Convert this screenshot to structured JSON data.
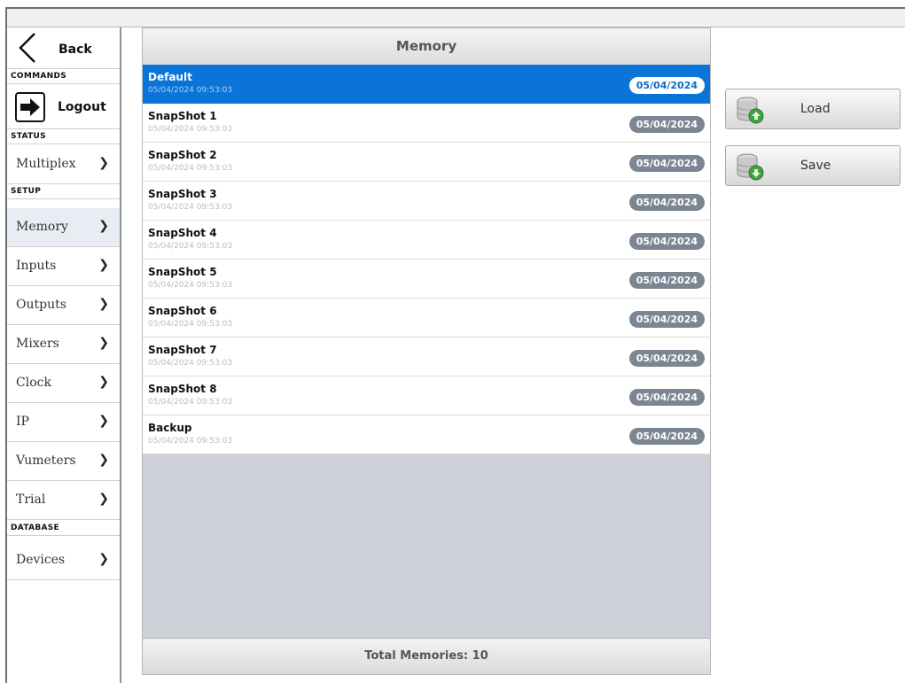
{
  "sidebar": {
    "back_label": "Back",
    "sections": {
      "commands": "COMMANDS",
      "status": "STATUS",
      "setup": "SETUP",
      "database": "DATABASE"
    },
    "logout_label": "Logout",
    "items": [
      {
        "label": "Multiplex"
      },
      {
        "label": "Memory",
        "active": true
      },
      {
        "label": "Inputs"
      },
      {
        "label": "Outputs"
      },
      {
        "label": "Mixers"
      },
      {
        "label": "Clock"
      },
      {
        "label": "IP"
      },
      {
        "label": "Vumeters"
      },
      {
        "label": "Trial"
      },
      {
        "label": "Devices"
      }
    ],
    "chevron_icon": "chevron-right-icon"
  },
  "memory": {
    "title": "Memory",
    "rows": [
      {
        "name": "Default",
        "timestamp": "05/04/2024 09:53:03",
        "date": "05/04/2024",
        "selected": true
      },
      {
        "name": "SnapShot 1",
        "timestamp": "05/04/2024 09:53:03",
        "date": "05/04/2024"
      },
      {
        "name": "SnapShot 2",
        "timestamp": "05/04/2024 09:53:03",
        "date": "05/04/2024"
      },
      {
        "name": "SnapShot 3",
        "timestamp": "05/04/2024 09:53:03",
        "date": "05/04/2024"
      },
      {
        "name": "SnapShot 4",
        "timestamp": "05/04/2024 09:53:03",
        "date": "05/04/2024"
      },
      {
        "name": "SnapShot 5",
        "timestamp": "05/04/2024 09:53:03",
        "date": "05/04/2024"
      },
      {
        "name": "SnapShot 6",
        "timestamp": "05/04/2024 09:53:03",
        "date": "05/04/2024"
      },
      {
        "name": "SnapShot 7",
        "timestamp": "05/04/2024 09:53:03",
        "date": "05/04/2024"
      },
      {
        "name": "SnapShot 8",
        "timestamp": "05/04/2024 09:53:03",
        "date": "05/04/2024"
      },
      {
        "name": "Backup",
        "timestamp": "05/04/2024 09:53:03",
        "date": "05/04/2024"
      }
    ],
    "footer": "Total Memories: 10"
  },
  "actions": {
    "load_label": "Load",
    "save_label": "Save",
    "load_icon": "database-load-icon",
    "save_icon": "database-save-icon"
  },
  "colors": {
    "selected_row": "#0b74d8",
    "badge": "#7c8693",
    "panel_bg": "#cdd0d6"
  }
}
